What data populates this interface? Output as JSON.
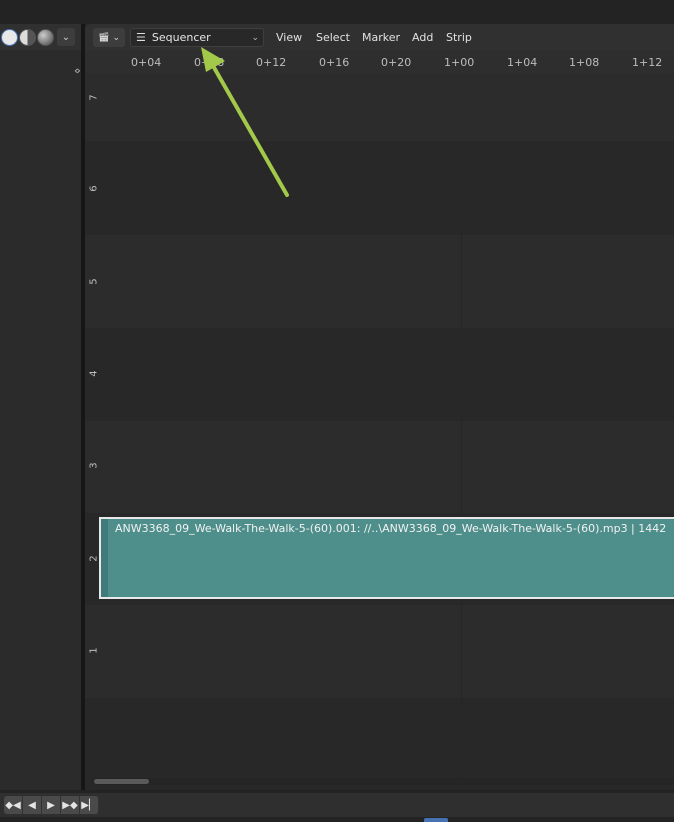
{
  "header": {
    "editor_type_icon": "film-clapper-icon",
    "mode_selector": {
      "icon": "sequencer-icon",
      "label": "Sequencer"
    },
    "menus": [
      "View",
      "Select",
      "Marker",
      "Add",
      "Strip"
    ]
  },
  "left_header": {
    "shading_modes": [
      "solid-shading-icon",
      "material-shading-icon",
      "rendered-shading-icon"
    ]
  },
  "timeline": {
    "ticks": [
      "0+04",
      "0+08",
      "0+12",
      "0+16",
      "0+20",
      "1+00",
      "1+04",
      "1+08",
      "1+12"
    ],
    "channels": [
      "7",
      "6",
      "5",
      "4",
      "3",
      "2",
      "1"
    ]
  },
  "strip": {
    "label": "ANW3368_09_We-Walk-The-Walk-5-(60).001: //..\\ANW3368_09_We-Walk-The-Walk-5-(60).mp3 | 1442",
    "channel": "2",
    "color": "#4e8f8c"
  },
  "playback": {
    "buttons": [
      "jump-start-icon",
      "jump-prev-keyframe-icon",
      "play-reverse-icon",
      "play-icon",
      "jump-next-keyframe-icon",
      "jump-end-icon"
    ]
  },
  "annotation": {
    "arrow_color": "#a3c94a"
  }
}
